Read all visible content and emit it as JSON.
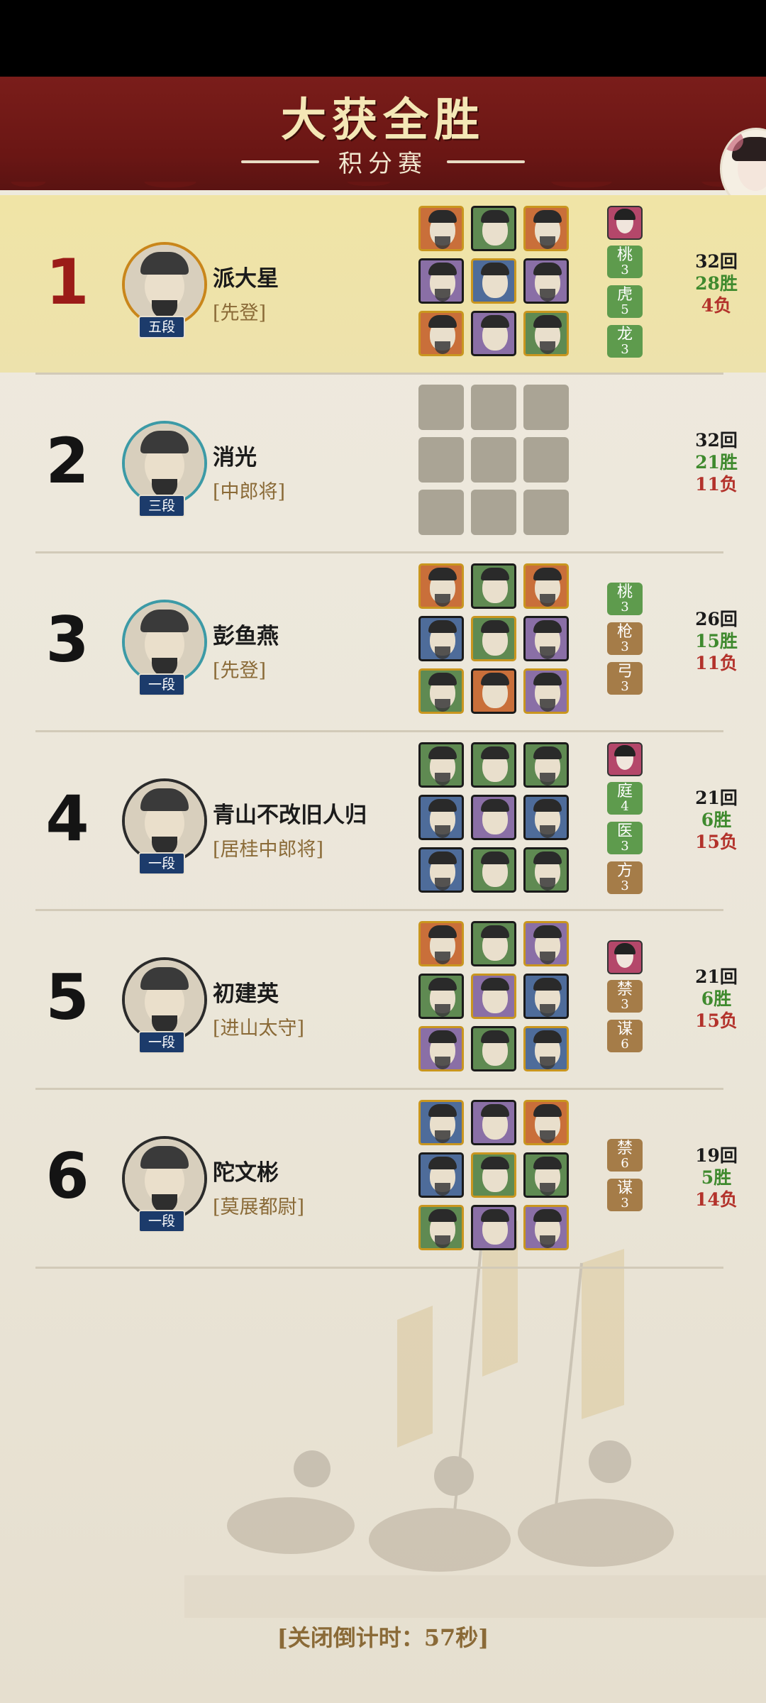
{
  "header": {
    "title": "大获全胜",
    "subtitle": "积分赛"
  },
  "players": [
    {
      "rank": "1",
      "name": "派大星",
      "title": "[先登]",
      "dan": "五段",
      "rounds": "32回",
      "wins": "28胜",
      "losses": "4负",
      "tags": [
        {
          "type": "portrait"
        },
        {
          "label": "桃",
          "count": "3",
          "color": "green"
        },
        {
          "label": "虎",
          "count": "5",
          "color": "green"
        },
        {
          "label": "龙",
          "count": "3",
          "color": "green"
        }
      ]
    },
    {
      "rank": "2",
      "name": "消光",
      "title": "[中郎将]",
      "dan": "三段",
      "rounds": "32回",
      "wins": "21胜",
      "losses": "11负",
      "tags": []
    },
    {
      "rank": "3",
      "name": "彭鱼燕",
      "title": "[先登]",
      "dan": "一段",
      "rounds": "26回",
      "wins": "15胜",
      "losses": "11负",
      "tags": [
        {
          "label": "桃",
          "count": "3",
          "color": "green"
        },
        {
          "label": "枪",
          "count": "3",
          "color": "brown"
        },
        {
          "label": "弓",
          "count": "3",
          "color": "brown"
        }
      ]
    },
    {
      "rank": "4",
      "name": "青山不改旧人归",
      "title": "[居桂中郎将]",
      "dan": "一段",
      "rounds": "21回",
      "wins": "6胜",
      "losses": "15负",
      "tags": [
        {
          "type": "portrait"
        },
        {
          "label": "庭",
          "count": "4",
          "color": "green"
        },
        {
          "label": "医",
          "count": "3",
          "color": "green"
        },
        {
          "label": "方",
          "count": "3",
          "color": "brown"
        }
      ]
    },
    {
      "rank": "5",
      "name": "初建英",
      "title": "[进山太守]",
      "dan": "一段",
      "rounds": "21回",
      "wins": "6胜",
      "losses": "15负",
      "tags": [
        {
          "type": "portrait"
        },
        {
          "label": "禁",
          "count": "3",
          "color": "brown"
        },
        {
          "label": "谋",
          "count": "6",
          "color": "brown"
        }
      ]
    },
    {
      "rank": "6",
      "name": "陀文彬",
      "title": "[莫展都尉]",
      "dan": "一段",
      "rounds": "19回",
      "wins": "5胜",
      "losses": "14负",
      "tags": [
        {
          "label": "禁",
          "count": "6",
          "color": "brown"
        },
        {
          "label": "谋",
          "count": "3",
          "color": "brown"
        }
      ]
    }
  ],
  "footer": {
    "countdown": "[关闭倒计时：57秒]"
  }
}
